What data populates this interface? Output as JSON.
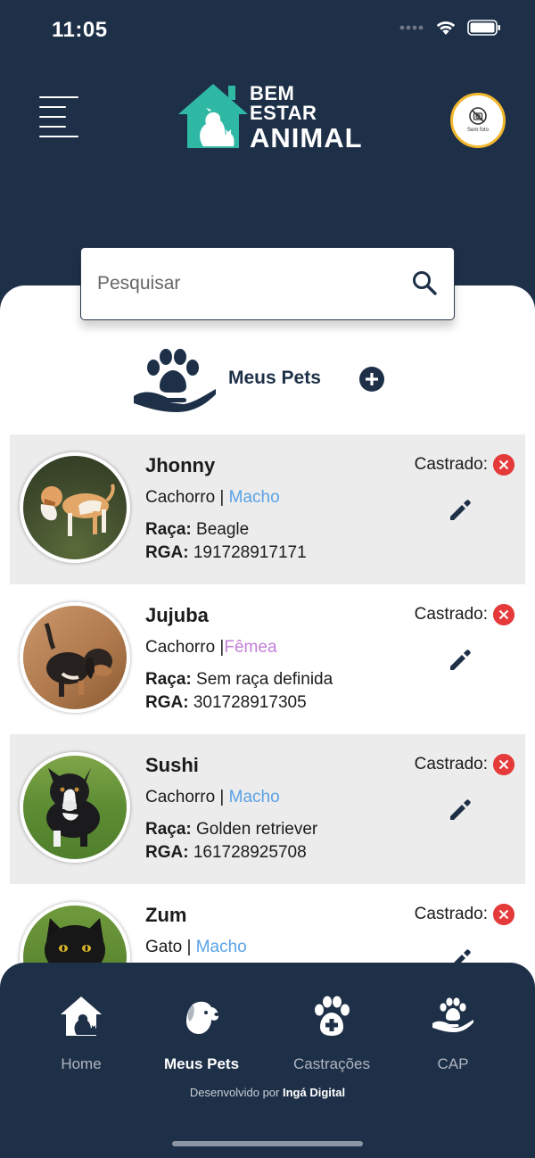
{
  "status": {
    "time": "11:05"
  },
  "header": {
    "logo": {
      "line1": "BEM",
      "line2": "ESTAR",
      "line3": "ANIMAL"
    },
    "avatar_label": "Sem foto",
    "menu_icon": "hamburger-menu-icon"
  },
  "search": {
    "placeholder": "Pesquisar",
    "value": ""
  },
  "section": {
    "title": "Meus Pets"
  },
  "pets": [
    {
      "name": "Jhonny",
      "species": "Cachorro",
      "sex": "Macho",
      "breed_label": "Raça:",
      "breed": "Beagle",
      "rga_label": "RGA:",
      "rga": "191728917171",
      "castrated_label": "Castrado:",
      "castrated": false
    },
    {
      "name": "Jujuba",
      "species": "Cachorro",
      "sex": "Fêmea",
      "breed_label": "Raça:",
      "breed": "Sem raça definida",
      "rga_label": "RGA:",
      "rga": "301728917305",
      "castrated_label": "Castrado:",
      "castrated": false
    },
    {
      "name": "Sushi",
      "species": "Cachorro",
      "sex": "Macho",
      "breed_label": "Raça:",
      "breed": "Golden retriever",
      "rga_label": "RGA:",
      "rga": "161728925708",
      "castrated_label": "Castrado:",
      "castrated": false
    },
    {
      "name": "Zum",
      "species": "Gato",
      "sex": "Macho",
      "castrated_label": "Castrado:",
      "castrated": false
    }
  ],
  "tabs": [
    {
      "label": "Home",
      "icon": "house-pet-icon",
      "active": false
    },
    {
      "label": "Meus Pets",
      "icon": "dog-head-icon",
      "active": true
    },
    {
      "label": "Castrações",
      "icon": "paw-cross-icon",
      "active": false
    },
    {
      "label": "CAP",
      "icon": "hand-paw-icon",
      "active": false
    }
  ],
  "footer": {
    "prefix": "Desenvolvido por",
    "company": "Ingá Digital"
  },
  "colors": {
    "navy": "#1e3048",
    "teal": "#2fb9a5",
    "avatar_ring": "#f2b72c",
    "male": "#5aa2e6",
    "female": "#c27fd8",
    "not_castrated": "#e53a3a"
  }
}
